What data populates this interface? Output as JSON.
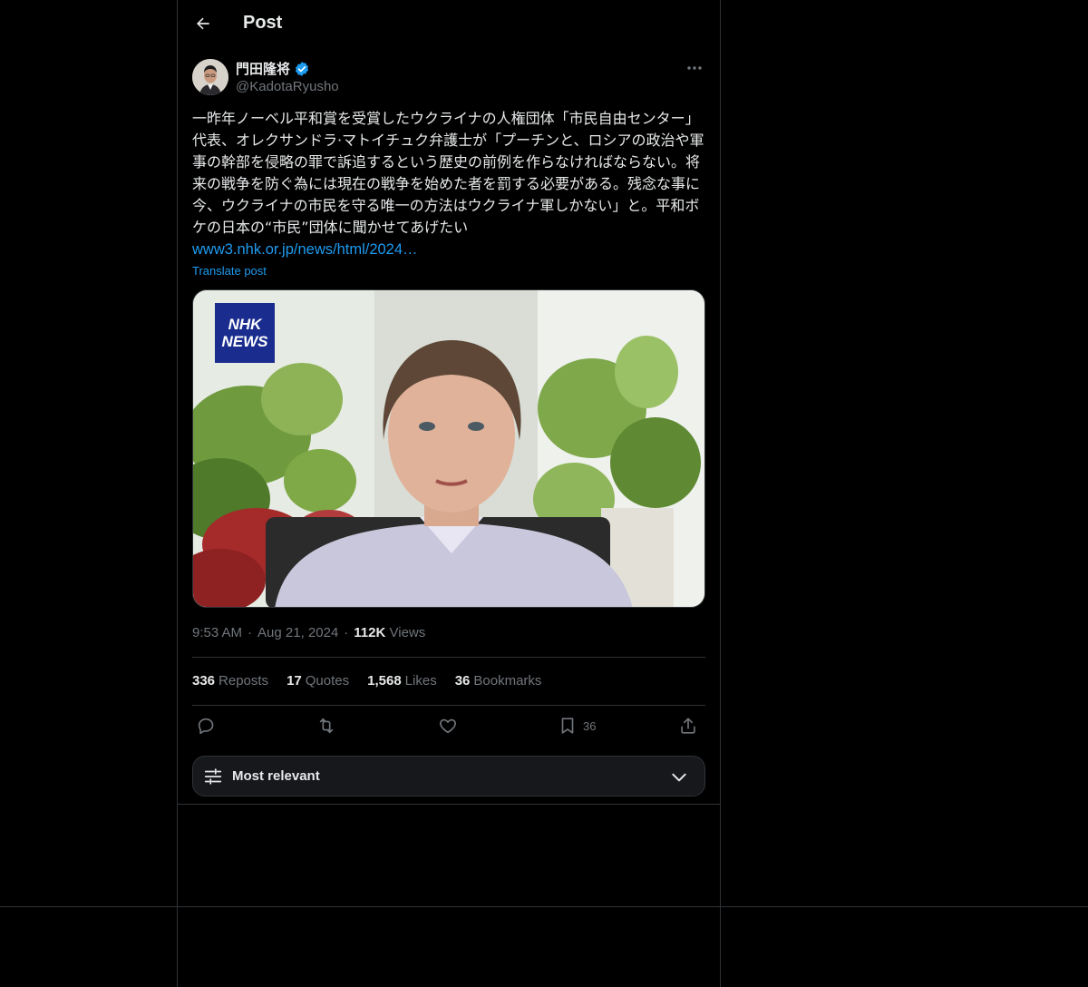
{
  "header": {
    "title": "Post"
  },
  "author": {
    "name": "門田隆将",
    "handle": "@KadotaRyusho"
  },
  "post": {
    "text": "一昨年ノーベル平和賞を受賞したウクライナの人権団体「市民自由センター」代表、オレクサンドラ·マトイチュク弁護士が「プーチンと、ロシアの政治や軍事の幹部を侵略の罪で訴追するという歴史の前例を作らなければならない。将来の戦争を防ぐ為には現在の戦争を始めた者を罰する必要がある。残念な事に今、ウクライナの市民を守る唯一の方法はウクライナ軍しかない」と。平和ボケの日本の“市民”団体に聞かせてあげたい",
    "link": "www3.nhk.or.jp/news/html/2024…",
    "translate": "Translate post"
  },
  "media": {
    "badge_line1": "NHK",
    "badge_line2": "NEWS",
    "badge_color": "#1a2d8f"
  },
  "meta": {
    "time": "9:53 AM",
    "date": "Aug 21, 2024",
    "views_count": "112K",
    "views_label": "Views",
    "separator": "·"
  },
  "stats": {
    "reposts_count": "336",
    "reposts_label": "Reposts",
    "quotes_count": "17",
    "quotes_label": "Quotes",
    "likes_count": "1,568",
    "likes_label": "Likes",
    "bookmarks_count": "36",
    "bookmarks_label": "Bookmarks"
  },
  "actions": {
    "bookmark_count": "36"
  },
  "sort": {
    "label": "Most relevant"
  },
  "icons": [
    "back-arrow-icon",
    "verified-badge-icon",
    "more-icon",
    "reply-icon",
    "repost-icon",
    "like-icon",
    "bookmark-icon",
    "share-icon",
    "filter-icon",
    "chevron-down-icon"
  ],
  "colors": {
    "background": "#000000",
    "text": "#e7e9ea",
    "secondary": "#71767b",
    "link": "#1d9bf0",
    "border": "#2f3336"
  }
}
